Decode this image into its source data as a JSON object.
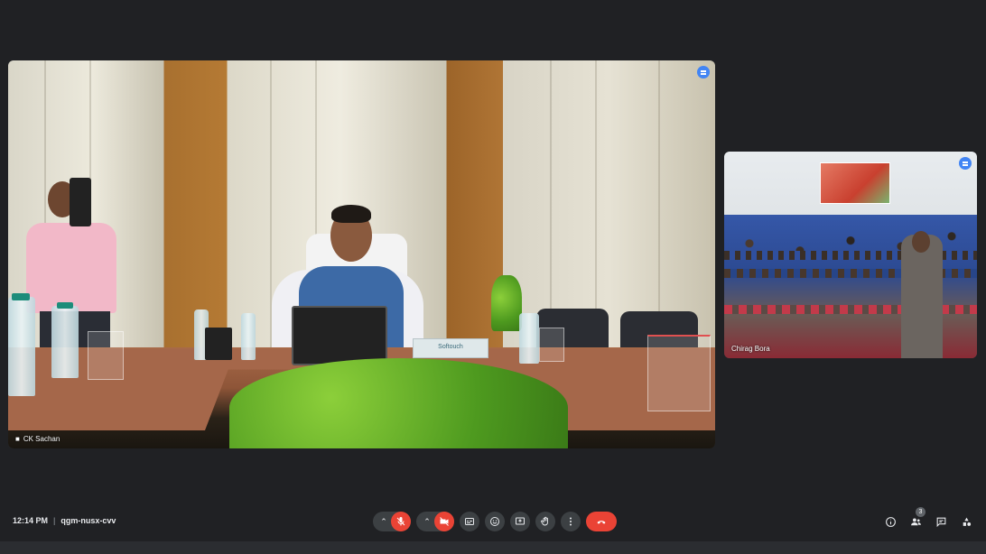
{
  "meeting": {
    "time": "12:14 PM",
    "separator": "|",
    "code": "qgm-nusx-cvv"
  },
  "tiles": {
    "main": {
      "participant_name": "CK Sachan",
      "tissue_label": "Softouch",
      "pinned_icon": "more-options-icon"
    },
    "side": {
      "participant_name": "Chirag Bora",
      "pinned_icon": "more-options-icon"
    }
  },
  "controls": {
    "mic": {
      "icon": "mic-off-icon",
      "state": "off",
      "color": "#ea4335"
    },
    "camera": {
      "icon": "camera-off-icon",
      "state": "off",
      "color": "#ea4335"
    },
    "captions": {
      "icon": "captions-icon"
    },
    "reactions": {
      "icon": "emoji-icon"
    },
    "present": {
      "icon": "present-screen-icon"
    },
    "raise_hand": {
      "icon": "raise-hand-icon"
    },
    "more": {
      "icon": "more-vert-icon"
    },
    "hangup": {
      "icon": "call-end-icon",
      "color": "#ea4335"
    }
  },
  "right_controls": {
    "info": {
      "icon": "info-icon"
    },
    "people": {
      "icon": "people-icon",
      "count": "3"
    },
    "chat": {
      "icon": "chat-icon"
    },
    "activities": {
      "icon": "activities-icon"
    }
  }
}
